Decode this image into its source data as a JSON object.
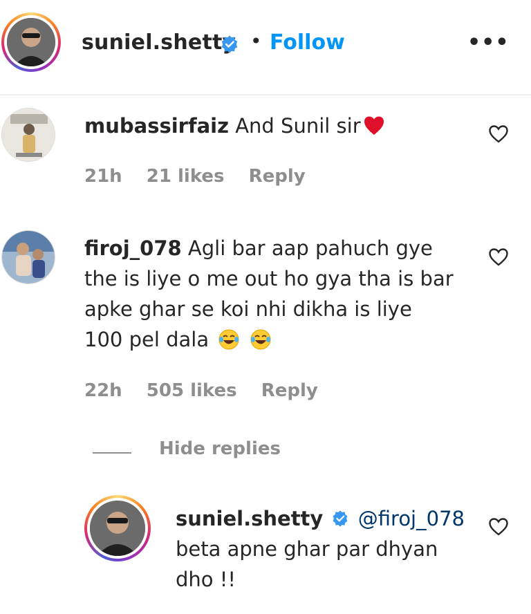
{
  "header": {
    "username": "suniel.shetty",
    "separator": "•",
    "follow_label": "Follow",
    "more_label": "•••"
  },
  "comments": [
    {
      "username": "mubassirfaiz",
      "text": "And Sunil sir",
      "emoji": "red-heart",
      "time": "21h",
      "likes": "21 likes",
      "reply_label": "Reply"
    },
    {
      "username": "firoj_078",
      "lines": [
        "Agli bar aap pahuch gye",
        "the is liye o me out ho gya tha is bar",
        "apke ghar se koi nhi dikha is liye",
        "100 pel dala"
      ],
      "emoji": "face-with-tears-of-joy",
      "time": "22h",
      "likes": "505 likes",
      "reply_label": "Reply",
      "hide_replies_label": "Hide replies"
    }
  ],
  "reply": {
    "username": "suniel.shetty",
    "mention": "@firoj_078",
    "lines": [
      "beta apne ghar par dhyan",
      "dho !!"
    ]
  },
  "colors": {
    "follow_blue": "#0095f6",
    "verified_blue": "#3897f0",
    "meta_gray": "#8e8e8e",
    "heart_red": "#e0102a"
  }
}
